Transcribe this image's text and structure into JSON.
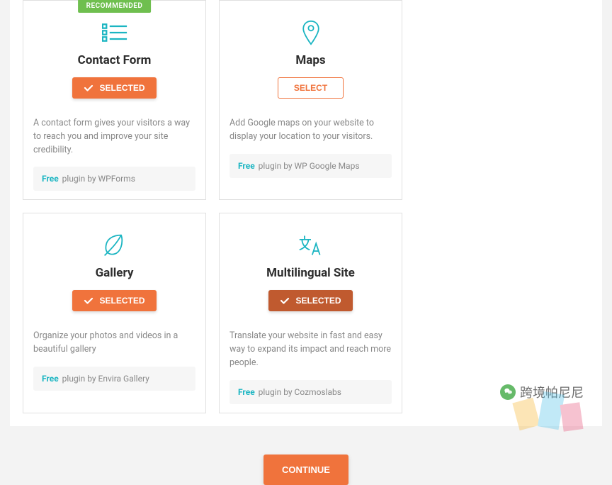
{
  "cards": [
    {
      "recommended": true,
      "recommended_label": "RECOMMENDED",
      "title": "Contact Form",
      "button_state": "selected",
      "button_label": "SELECTED",
      "description": "A contact form gives your visitors a way to reach you and improve your site credibility.",
      "free_label": "Free",
      "plugin_text": "plugin by WPForms"
    },
    {
      "recommended": false,
      "title": "Maps",
      "button_state": "select",
      "button_label": "SELECT",
      "description": "Add Google maps on your website to display your location to your visitors.",
      "free_label": "Free",
      "plugin_text": "plugin by WP Google Maps"
    },
    {
      "recommended": false,
      "title": "Gallery",
      "button_state": "selected",
      "button_label": "SELECTED",
      "description": "Organize your photos and videos in a beautiful gallery",
      "free_label": "Free",
      "plugin_text": "plugin by Envira Gallery"
    },
    {
      "recommended": false,
      "title": "Multilingual Site",
      "button_state": "selected-dark",
      "button_label": "SELECTED",
      "description": "Translate your website in fast and easy way to expand its impact and reach more people.",
      "free_label": "Free",
      "plugin_text": "plugin by Cozmoslabs"
    }
  ],
  "continue_label": "CONTINUE",
  "watermark_text": "跨境帕尼尼"
}
